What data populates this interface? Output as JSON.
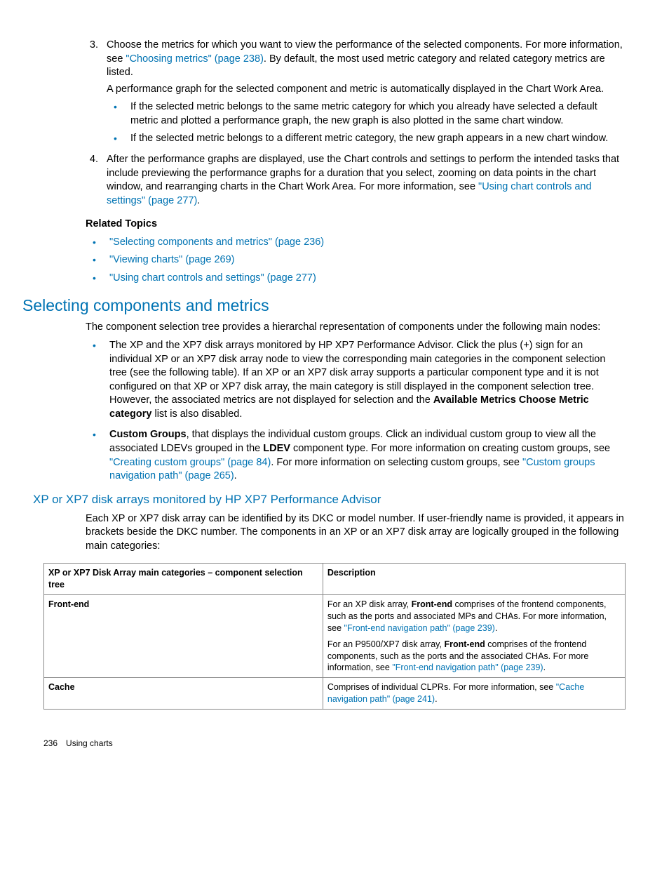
{
  "step3": {
    "num": "3.",
    "p1a": "Choose the metrics for which you want to view the performance of the selected components. For more information, see ",
    "link1": "\"Choosing metrics\" (page 238)",
    "p1b": ". By default, the most used metric category and related category metrics are listed.",
    "p2": "A performance graph for the selected component and metric is automatically displayed in the Chart Work Area.",
    "b1": "If the selected metric belongs to the same metric category for which you already have selected a default metric and plotted a performance graph, the new graph is also plotted in the same chart window.",
    "b2": "If the selected metric belongs to a different metric category, the new graph appears in a new chart window."
  },
  "step4": {
    "num": "4.",
    "a": "After the performance graphs are displayed, use the Chart controls and settings to perform the intended tasks that include previewing the performance graphs for a duration that you select, zooming on data points in the chart window, and rearranging charts in the Chart Work Area. For more information, see ",
    "link": "\"Using chart controls and settings\" (page 277)",
    "end": "."
  },
  "related": {
    "heading": "Related Topics",
    "l1": "\"Selecting components and metrics\" (page 236)",
    "l2": "\"Viewing charts\" (page 269)",
    "l3": "\"Using chart controls and settings\" (page 277)"
  },
  "section": {
    "title": "Selecting components and metrics",
    "intro": "The component selection tree provides a hierarchal representation of components under the following main nodes:",
    "b1a": "The XP and the XP7 disk arrays monitored by HP XP7 Performance Advisor. Click the plus (+) sign for an individual XP or an XP7 disk array node to view the corresponding main categories in the component selection tree (see the following table). If an XP or an XP7 disk array supports a particular component type and it is not configured on that XP or XP7 disk array, the main category is still displayed in the component selection tree. However, the associated metrics are not displayed for selection and the ",
    "b1bold": "Available Metrics Choose Metric category",
    "b1b": " list is also disabled.",
    "b2bold1": "Custom Groups",
    "b2a": ", that displays the individual custom groups. Click an individual custom group to view all the associated LDEVs grouped in the ",
    "b2bold2": "LDEV",
    "b2b": " component type. For more information on creating custom groups, see ",
    "b2link1": "\"Creating custom groups\" (page 84)",
    "b2c": ". For more information on selecting custom groups, see ",
    "b2link2": "\"Custom groups navigation path\" (page 265)",
    "b2d": "."
  },
  "subsection": {
    "title": "XP or XP7 disk arrays monitored by HP XP7 Performance Advisor",
    "intro": "Each XP or XP7 disk array can be identified by its DKC or model number. If user-friendly name is provided, it appears in brackets beside the DKC number. The components in an XP or an XP7 disk array are logically grouped in the following main categories:"
  },
  "table": {
    "h1": "XP or XP7 Disk Array main categories – component selection tree",
    "h2": "Description",
    "r1c1": "Front-end",
    "r1p1a": "For an XP disk array, ",
    "r1p1bold": "Front-end",
    "r1p1b": " comprises of the frontend components, such as the ports and associated MPs and CHAs. For more information, see ",
    "r1p1link": "\"Front-end navigation path\" (page 239)",
    "r1p1end": ".",
    "r1p2a": "For an P9500/XP7 disk array, ",
    "r1p2bold": "Front-end",
    "r1p2b": " comprises of the frontend components, such as the ports and the associated CHAs. For more information, see ",
    "r1p2link": "\"Front-end navigation path\" (page 239)",
    "r1p2end": ".",
    "r2c1": "Cache",
    "r2a": "Comprises of individual CLPRs. For more information, see ",
    "r2link": "\"Cache navigation path\" (page 241)",
    "r2end": "."
  },
  "footer": {
    "page": "236",
    "label": "Using charts"
  }
}
